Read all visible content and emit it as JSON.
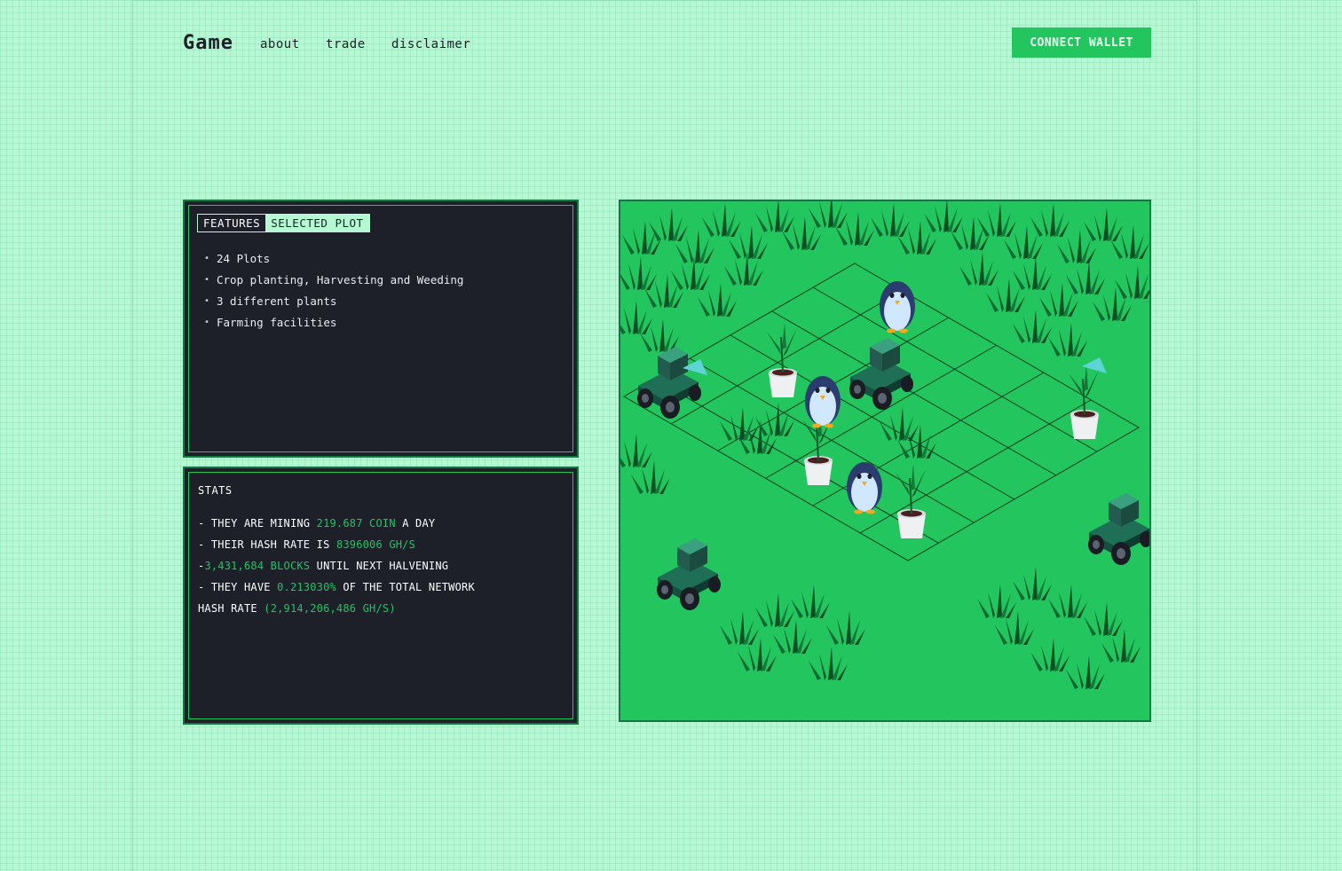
{
  "header": {
    "logo": "Game",
    "nav": [
      {
        "label": "about"
      },
      {
        "label": "trade"
      },
      {
        "label": "disclaimer"
      }
    ],
    "connect_label": "CONNECT WALLET"
  },
  "features_panel": {
    "tabs": [
      {
        "label": "FEATURES",
        "active": true
      },
      {
        "label": "SELECTED PLOT",
        "active": false
      }
    ],
    "items": [
      "24 Plots",
      "Crop planting, Harvesting and Weeding",
      "3 different plants",
      "Farming facilities"
    ]
  },
  "stats_panel": {
    "title": "STATS",
    "line1_prefix": "- THEY ARE MINING",
    "mining_value": "219.687 COIN",
    "line1_suffix": "A DAY",
    "line2_prefix": "- THEIR HASH RATE IS",
    "hash_value": "8396006 GH/S",
    "line3_prefix": "-",
    "blocks_value": "3,431,684 BLOCKS",
    "line3_suffix": "UNTIL NEXT HALVENING",
    "line4_prefix": "- THEY HAVE",
    "percent_value": "0.213030%",
    "line4_suffix": "OF THE TOTAL NETWORK",
    "line5_prefix": "HASH RATE",
    "network_value": "(2,914,206,486 GH/S)"
  },
  "colors": {
    "background": "#b6f7d4",
    "accent": "#22c55e",
    "panel": "#1d1f29",
    "border": "#0f7a3d"
  },
  "icons": [
    "tractor-icon",
    "penguin-icon",
    "potted-plant-icon",
    "crop-bush-icon"
  ]
}
